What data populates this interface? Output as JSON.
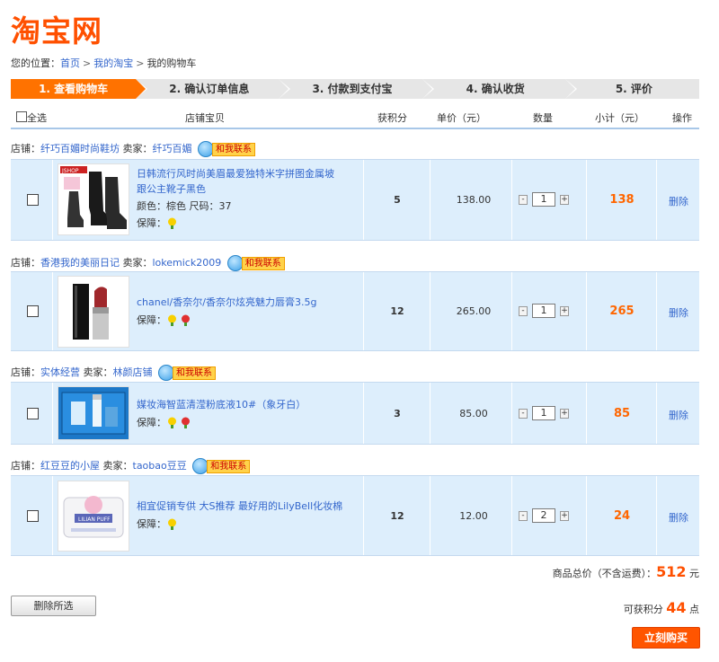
{
  "logo": "淘宝网",
  "breadcrumb": {
    "prefix": "您的位置：",
    "home": "首页",
    "my": "我的淘宝",
    "current": "我的购物车",
    "sep": ">"
  },
  "steps": [
    "1. 查看购物车",
    "2. 确认订单信息",
    "3. 付款到支付宝",
    "4. 确认收货",
    "5. 评价"
  ],
  "header": {
    "select_all": "全选",
    "item": "店铺宝贝",
    "points": "获积分",
    "price": "单价（元）",
    "qty": "数量",
    "subtotal": "小计（元）",
    "action": "操作"
  },
  "shop_label": "店铺：",
  "seller_label": "卖家：",
  "contact_label": "和我联系",
  "guarantee_label": "保障：",
  "qty_minus": "-",
  "qty_plus": "+",
  "delete_label": "删除",
  "items": [
    {
      "shop": "纤巧百媚时尚鞋坊",
      "seller": "纤巧百媚",
      "title_1": "日韩流行风时尚美眉最爱独特米字拼图金属坡",
      "title_2": "跟公主靴子黑色",
      "color_size": "颜色：棕色 尺码：37",
      "points": "5",
      "price": "138.00",
      "qty": "1",
      "subtotal": "138"
    },
    {
      "shop": "香港我的美丽日记",
      "seller": "lokemick2009",
      "title_1": "chanel/香奈尔/香奈尔炫亮魅力唇膏3.5g",
      "points": "12",
      "price": "265.00",
      "qty": "1",
      "subtotal": "265"
    },
    {
      "shop": "实体经营",
      "seller": "林颜店铺",
      "title_1": "媒妆海智蓝清滢粉底液10#（象牙白）",
      "points": "3",
      "price": "85.00",
      "qty": "1",
      "subtotal": "85"
    },
    {
      "shop": "红豆豆的小屋",
      "seller": "taobao豆豆",
      "title_1": "相宜促销专供 大S推荐 最好用的LilyBell化妆棉",
      "points": "12",
      "price": "12.00",
      "qty": "2",
      "subtotal": "24"
    }
  ],
  "total": {
    "label": "商品总价（不含运费）：",
    "value": "512",
    "unit": "元"
  },
  "points_total": {
    "label": "可获积分",
    "value": "44",
    "unit": "点"
  },
  "delete_selected": "删除所选",
  "buy_now": "立刻购买",
  "colors": {
    "accent": "#ff5000",
    "link": "#3366cc",
    "row_bg": "#ddeefc",
    "step_active": "#ff7200"
  }
}
